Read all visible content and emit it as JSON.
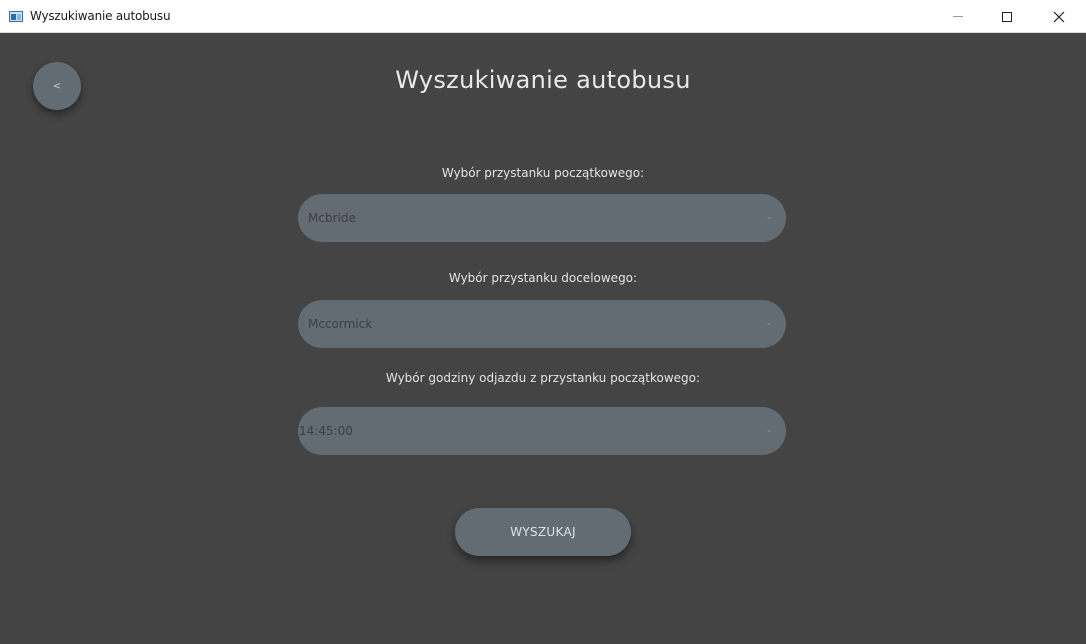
{
  "window": {
    "title": "Wyszukiwanie autobusu",
    "minimize_icon": "minimize-icon",
    "maximize_icon": "maximize-icon",
    "close_icon": "close-icon"
  },
  "header": {
    "back_label": "<",
    "title": "Wyszukiwanie autobusu"
  },
  "form": {
    "start_stop": {
      "label": "Wybór przystanku początkowego:",
      "value": "Mcbride"
    },
    "end_stop": {
      "label": "Wybór przystanku docelowego:",
      "value": "Mccormick"
    },
    "departure_time": {
      "label": "Wybór godziny odjazdu z przystanku początkowego:",
      "value": "14:45:00"
    },
    "dropdown_icon": "chevron-down-icon",
    "search_label": "WYSZUKAJ"
  },
  "colors": {
    "background": "#444444",
    "control": "#636c73",
    "text": "#e4e4e4"
  }
}
